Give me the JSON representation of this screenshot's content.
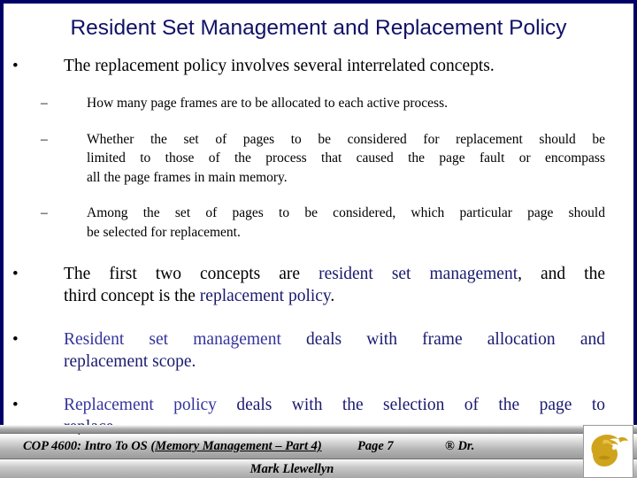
{
  "slide": {
    "title": "Resident Set Management and Replacement Policy",
    "colors": {
      "title": "#111166",
      "border": "#000066",
      "accent_navy": "#1a1a70",
      "accent_blue": "#33339e",
      "body_text": "#000000",
      "logo_gold": "#cfa41c"
    },
    "bullets": [
      {
        "level": 1,
        "marker": "•",
        "text": "The replacement policy involves several interrelated concepts."
      },
      {
        "level": 2,
        "marker": "–",
        "text": "How many page frames are to be allocated to each active process."
      },
      {
        "level": 2,
        "marker": "–",
        "lines": [
          "Whether the set of pages to be considered for replacement should be",
          "limited to those of the process that caused the page fault or encompass",
          "all the page frames in main memory."
        ]
      },
      {
        "level": 2,
        "marker": "–",
        "lines": [
          "Among the set of pages to be considered, which particular page should",
          "be selected for replacement."
        ]
      },
      {
        "level": 1,
        "marker": "•",
        "line1_a": "The first two concepts are ",
        "line1_hl": "resident set management",
        "line1_b": ", and the",
        "line2_a": "third concept is the ",
        "line2_hl": "replacement policy",
        "line2_b": "."
      },
      {
        "level": 1,
        "marker": "•",
        "line1_hl": "Resident set management",
        "line1_b": " deals with frame allocation and",
        "line2_b": "replacement scope."
      },
      {
        "level": 1,
        "marker": "•",
        "line1_hl": "Replacement policy",
        "line1_b": " deals with the selection of the page to",
        "line2_b": "replace."
      }
    ]
  },
  "footer": {
    "course": "COP 4600: Intro To OS  ",
    "course_underlined": "(Memory Management – Part 4)",
    "page": "Page 7",
    "copyright": "® Dr.",
    "author": "Mark Llewellyn",
    "logo_name": "ucf-pegasus-logo"
  }
}
